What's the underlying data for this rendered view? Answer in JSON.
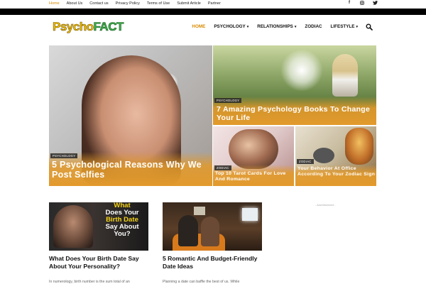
{
  "topbar": {
    "menu": [
      "Home",
      "About Us",
      "Contact us",
      "Privacy Policy",
      "Terms of Use",
      "Submit Article",
      "Partner"
    ],
    "active_index": 0,
    "social": [
      {
        "icon": "facebook-icon",
        "glyph": "f"
      },
      {
        "icon": "instagram-icon",
        "glyph": "◘"
      },
      {
        "icon": "twitter-icon",
        "glyph": "✦"
      }
    ]
  },
  "header": {
    "logo_part1": "Psycho",
    "logo_part2": "FACT",
    "nav": [
      {
        "label": "HOME",
        "active": true,
        "dropdown": false
      },
      {
        "label": "PSYCHOLOGY",
        "active": false,
        "dropdown": true
      },
      {
        "label": "RELATIONSHIPS",
        "active": false,
        "dropdown": true
      },
      {
        "label": "ZODIAC",
        "active": false,
        "dropdown": false
      },
      {
        "label": "LIFESTYLE",
        "active": false,
        "dropdown": true
      }
    ]
  },
  "featured": [
    {
      "category": "PSYCHOLOGY",
      "title": "5 Psychological Reasons Why We Post Selfies"
    },
    {
      "category": "PSYCHOLOGY",
      "title": "7 Amazing Psychology Books To Change Your Life"
    },
    {
      "category": "ZODIAC",
      "title": "Top 10 Tarot Cards For Love And Romance"
    },
    {
      "category": "ZODIAC",
      "title": "Your Behavior At Office According To Your Zodiac Sign"
    }
  ],
  "articles": [
    {
      "thumb_text": [
        "What",
        "Does Your",
        "Birth Date",
        "Say About",
        "You?"
      ],
      "headline": "What Does Your Birth Date Say About Your Personality?",
      "excerpt": "In numerology, birth number is the sum total of an"
    },
    {
      "headline": "5 Romantic And Budget-Friendly Date Ideas",
      "excerpt": "Planning a date can baffle the best of us. While"
    }
  ],
  "ad_label": "- Advertisement -",
  "colors": {
    "accent": "#d88b00",
    "overlay": "#e29a2c"
  }
}
